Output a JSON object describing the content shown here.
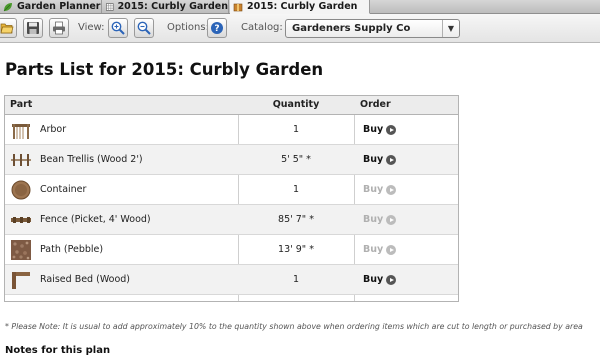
{
  "tabs": [
    {
      "label": "Garden Planner",
      "icon": "leaf-icon",
      "active": false
    },
    {
      "label": "2015: Curbly Garden",
      "icon": "grid-icon",
      "active": false
    },
    {
      "label": "2015: Curbly Garden",
      "icon": "box-icon",
      "active": true
    }
  ],
  "toolbar": {
    "view_label": "View:",
    "options_label": "Options:",
    "catalog_label": "Catalog:",
    "catalog_value": "Gardeners Supply Co",
    "buttons": [
      "open-folder-icon",
      "save-disk-icon",
      "print-icon",
      "zoom-in-icon",
      "zoom-out-icon",
      "help-icon"
    ]
  },
  "page": {
    "title": "Parts List for 2015: Curbly Garden"
  },
  "table": {
    "headers": {
      "part": "Part",
      "quantity": "Quantity",
      "order": "Order"
    },
    "buy_label": "Buy",
    "rows": [
      {
        "part": "Arbor",
        "quantity": "1",
        "buy_enabled": true
      },
      {
        "part": "Bean Trellis (Wood 2')",
        "quantity": "5' 5\" *",
        "buy_enabled": true
      },
      {
        "part": "Container",
        "quantity": "1",
        "buy_enabled": false
      },
      {
        "part": "Fence (Picket, 4' Wood)",
        "quantity": "85' 7\" *",
        "buy_enabled": false
      },
      {
        "part": "Path (Pebble)",
        "quantity": "13' 9\" *",
        "buy_enabled": false
      },
      {
        "part": "Raised Bed (Wood)",
        "quantity": "1",
        "buy_enabled": true
      }
    ]
  },
  "footnote": "* Please Note: It is usual to add approximately 10% to the quantity shown above when ordering items which are cut to length or purchased by area",
  "notes_heading": "Notes for this plan",
  "colors": {
    "accent_blue": "#2b64b8",
    "disabled_gray": "#b0b0b0"
  }
}
